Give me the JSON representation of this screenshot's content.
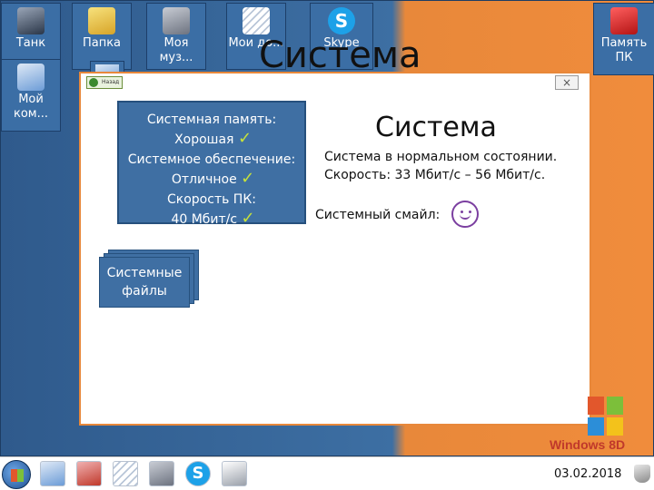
{
  "desktop": {
    "icons": {
      "tank": "Танк",
      "folder": "Папка",
      "music": "Моя муз...",
      "docs": "Мои до...",
      "skype": "Skype",
      "my_computer": "Мой ком...",
      "memory": "Память ПК"
    },
    "big_title": "Система",
    "brand": "Windows 8D"
  },
  "window": {
    "back_label": "Назад",
    "close_label": "×",
    "info_box": {
      "memory_label": "Системная память:",
      "memory_value": "Хорошая",
      "software_label": "Системное обеспечение:",
      "software_value": "Отличное",
      "speed_label": "Скорость ПК:",
      "speed_value": "40 Мбит/с",
      "check_glyph": "✓"
    },
    "title": "Система",
    "status_line1": "Система в нормальном состоянии.",
    "status_line2": "Скорость: 33 Мбит/с – 56 Мбит/с.",
    "smile_label": "Системный смайл:",
    "system_files_label": "Системные файлы"
  },
  "taskbar": {
    "skype_glyph": "S",
    "clock": "03.02.2018"
  },
  "colors": {
    "desktop_blue": "#3d6fa3",
    "desktop_orange": "#f08c3c",
    "check_green": "#c7e23a",
    "brand_red": "#c0392b"
  }
}
